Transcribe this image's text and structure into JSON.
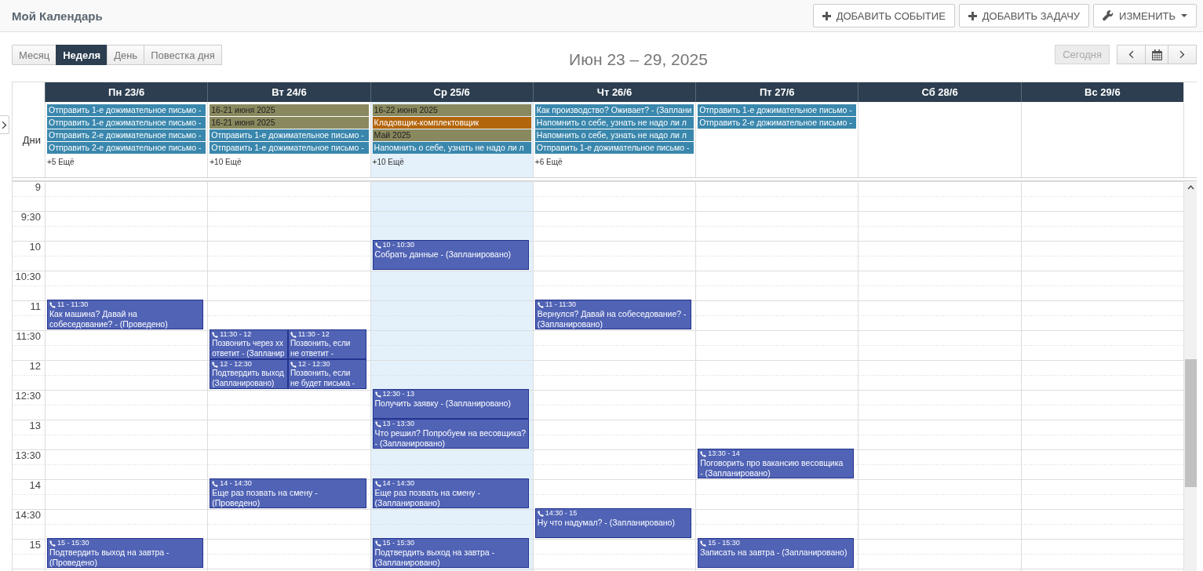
{
  "header": {
    "title": "Мой Календарь",
    "buttons": [
      {
        "kind": "add",
        "label": "ДОБАВИТЬ СОБЫТИЕ"
      },
      {
        "kind": "add",
        "label": "ДОБАВИТЬ ЗАДАЧУ"
      },
      {
        "kind": "menu",
        "label": "ИЗМЕНИТЬ"
      }
    ]
  },
  "toolbar": {
    "views": [
      {
        "label": "Месяц",
        "selected": false
      },
      {
        "label": "Неделя",
        "selected": true
      },
      {
        "label": "День",
        "selected": false
      },
      {
        "label": "Повестка дня",
        "selected": false
      }
    ],
    "title": "Июн 23 – 29, 2025",
    "today_button": {
      "label": "Сегодня",
      "disabled": true
    }
  },
  "calendar": {
    "all_day_label": "Дни",
    "days": [
      {
        "label": "Пн 23/6",
        "today": false,
        "all_day": [
          {
            "title": "Отправить 1-е дожимательное письмо -",
            "color": "#3a87ad"
          },
          {
            "title": "Отправить 1-е дожимательное письмо -",
            "color": "#3a87ad"
          },
          {
            "title": "Отправить 2-е дожимательное письмо -",
            "color": "#3a87ad"
          },
          {
            "title": "Отправить 2-е дожимательное письмо -",
            "color": "#3a87ad"
          }
        ],
        "more": "+5 Ещё"
      },
      {
        "label": "Вт 24/6",
        "today": false,
        "all_day": [
          {
            "title": "16-21 июня 2025",
            "color": "#8a885e"
          },
          {
            "title": "16-21 июня 2025",
            "color": "#8a885e"
          },
          {
            "title": "Отправить 1-е дожимательное письмо -",
            "color": "#3a87ad"
          },
          {
            "title": "Отправить 1-е дожимательное письмо -",
            "color": "#3a87ad"
          }
        ],
        "more": "+10 Ещё"
      },
      {
        "label": "Ср 25/6",
        "today": true,
        "all_day": [
          {
            "title": "16-22 июня 2025",
            "color": "#8a885e"
          },
          {
            "title": "Кладовщик-комплектовщик",
            "color": "#b3650b"
          },
          {
            "title": "Май 2025",
            "color": "#8a885e"
          },
          {
            "title": "Напомнить о себе, узнать не надо ли л",
            "color": "#3a87ad"
          }
        ],
        "more": "+10 Ещё"
      },
      {
        "label": "Чт 26/6",
        "today": false,
        "all_day": [
          {
            "title": "Как производство? Оживает? - (Заплани",
            "color": "#3a87ad"
          },
          {
            "title": "Напомнить о себе, узнать не надо ли л",
            "color": "#3a87ad"
          },
          {
            "title": "Напомнить о себе, узнать не надо ли л",
            "color": "#3a87ad"
          },
          {
            "title": "Отправить 1-е дожимательное письмо -",
            "color": "#3a87ad"
          }
        ],
        "more": "+6 Ещё"
      },
      {
        "label": "Пт 27/6",
        "today": false,
        "all_day": [
          {
            "title": "Отправить 1-е дожимательное письмо -",
            "color": "#3a87ad"
          },
          {
            "title": "Отправить 2-е дожимательное письмо -",
            "color": "#3a87ad"
          }
        ]
      },
      {
        "label": "Сб 28/6",
        "today": false
      },
      {
        "label": "Вс 29/6",
        "today": false
      }
    ],
    "time_slots": [
      {
        "label": "9"
      },
      {
        "label": "9:30"
      },
      {
        "label": "10",
        "cells": [
          null,
          null,
          [
            {
              "time": "10 - 10:30",
              "lines": [
                "Собрать данные - (Запланировано)"
              ]
            }
          ],
          null,
          null,
          null,
          null
        ]
      },
      {
        "label": "10:30"
      },
      {
        "label": "11",
        "cells": [
          [
            {
              "time": "11 - 11:30",
              "lines": [
                "Как машина? Давай на",
                "собеседование? - (Проведено)"
              ]
            }
          ],
          null,
          null,
          [
            {
              "time": "11 - 11:30",
              "lines": [
                "Вернулся? Давай на собеседование? -",
                "(Запланировано)"
              ]
            }
          ],
          null,
          null,
          null
        ]
      },
      {
        "label": "11:30",
        "cells": [
          null,
          [
            {
              "time": "11:30 - 12",
              "lines": [
                "Позвонить через хх",
                "ответит - (Запланир"
              ]
            },
            {
              "time": "11:30 - 12",
              "lines": [
                "Позвонить, если",
                "не ответит -"
              ]
            }
          ],
          null,
          null,
          null,
          null,
          null
        ]
      },
      {
        "label": "12",
        "cells": [
          null,
          [
            {
              "time": "12 - 12:30",
              "lines": [
                "Подтвердить выход",
                "(Запланировано)"
              ]
            },
            {
              "time": "12 - 12:30",
              "lines": [
                "Позвонить, если",
                "не будет письма -"
              ]
            }
          ],
          null,
          null,
          null,
          null,
          null
        ]
      },
      {
        "label": "12:30",
        "cells": [
          null,
          null,
          [
            {
              "time": "12:30 - 13",
              "lines": [
                "Получить заявку - (Запланировано)"
              ]
            }
          ],
          null,
          null,
          null,
          null
        ]
      },
      {
        "label": "13",
        "cells": [
          null,
          null,
          [
            {
              "time": "13 - 13:30",
              "lines": [
                "Что решил? Попробуем на весовщика?",
                "- (Запланировано)"
              ]
            }
          ],
          null,
          null,
          null,
          null
        ]
      },
      {
        "label": "13:30",
        "cells": [
          null,
          null,
          null,
          null,
          [
            {
              "time": "13:30 - 14",
              "lines": [
                "Поговорить про вакансию весовщика",
                "- (Запланировано)"
              ]
            }
          ],
          null,
          null
        ]
      },
      {
        "label": "14",
        "cells": [
          null,
          [
            {
              "time": "14 - 14:30",
              "lines": [
                "Еще раз позвать на смену -",
                "(Проведено)"
              ]
            }
          ],
          [
            {
              "time": "14 - 14:30",
              "lines": [
                "Еще раз позвать на смену -",
                "(Запланировано)"
              ]
            }
          ],
          null,
          null,
          null,
          null
        ]
      },
      {
        "label": "14:30",
        "cells": [
          null,
          null,
          null,
          [
            {
              "time": "14:30 - 15",
              "lines": [
                "Ну что надумал? - (Запланировано)"
              ]
            }
          ],
          null,
          null,
          null
        ]
      },
      {
        "label": "15",
        "cells": [
          [
            {
              "time": "15 - 15:30",
              "lines": [
                "Подтвердить выход на завтра -",
                "(Проведено)"
              ]
            }
          ],
          null,
          [
            {
              "time": "15 - 15:30",
              "lines": [
                "Подтвердить выход на завтра -",
                "(Запланировано)"
              ]
            }
          ],
          null,
          [
            {
              "time": "15 - 15:30",
              "lines": [
                "Записать на завтра - (Запланировано)"
              ]
            }
          ],
          null,
          null
        ]
      }
    ]
  }
}
